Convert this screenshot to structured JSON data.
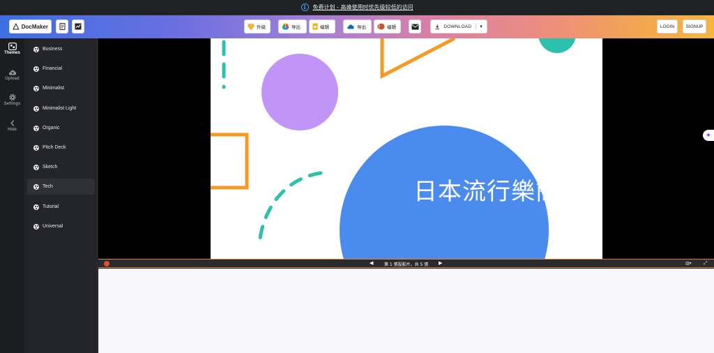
{
  "notice": {
    "text": "免费计划 - 高峰使用时优先级较低的访问"
  },
  "toolbar": {
    "logo_label": "DocMaker",
    "upgrade_label": "升级",
    "gdrive_export_label": "导出",
    "gdrive_edit_label": "编辑",
    "onedrive_export_label": "导出",
    "onedrive_edit_label": "编辑",
    "download_label": "DOWNLOAD",
    "login_label": "LOGIN",
    "signup_label": "SIGNUP"
  },
  "rail": {
    "items": [
      {
        "label": "Themes",
        "icon": "themes-icon"
      },
      {
        "label": "Upload",
        "icon": "cloud-upload-icon"
      },
      {
        "label": "Settings",
        "icon": "gear-icon"
      },
      {
        "label": "Hide",
        "icon": "chevron-left-icon"
      }
    ]
  },
  "themes": {
    "items": [
      {
        "label": "Business"
      },
      {
        "label": "Financial"
      },
      {
        "label": "Minimalist"
      },
      {
        "label": "Minimalist Light"
      },
      {
        "label": "Organic"
      },
      {
        "label": "Pitch Deck"
      },
      {
        "label": "Sketch"
      },
      {
        "label": "Tech"
      },
      {
        "label": "Tutorial"
      },
      {
        "label": "Universal"
      }
    ],
    "selected": "Tech"
  },
  "slide": {
    "title": "日本流行樂簡報"
  },
  "navbar": {
    "counter": "第 1 張投影片，共 5 張"
  },
  "colors": {
    "accent_blue": "#4b8bed",
    "purple": "#c195f7",
    "orange": "#f59a23",
    "teal": "#2bc1ac"
  }
}
